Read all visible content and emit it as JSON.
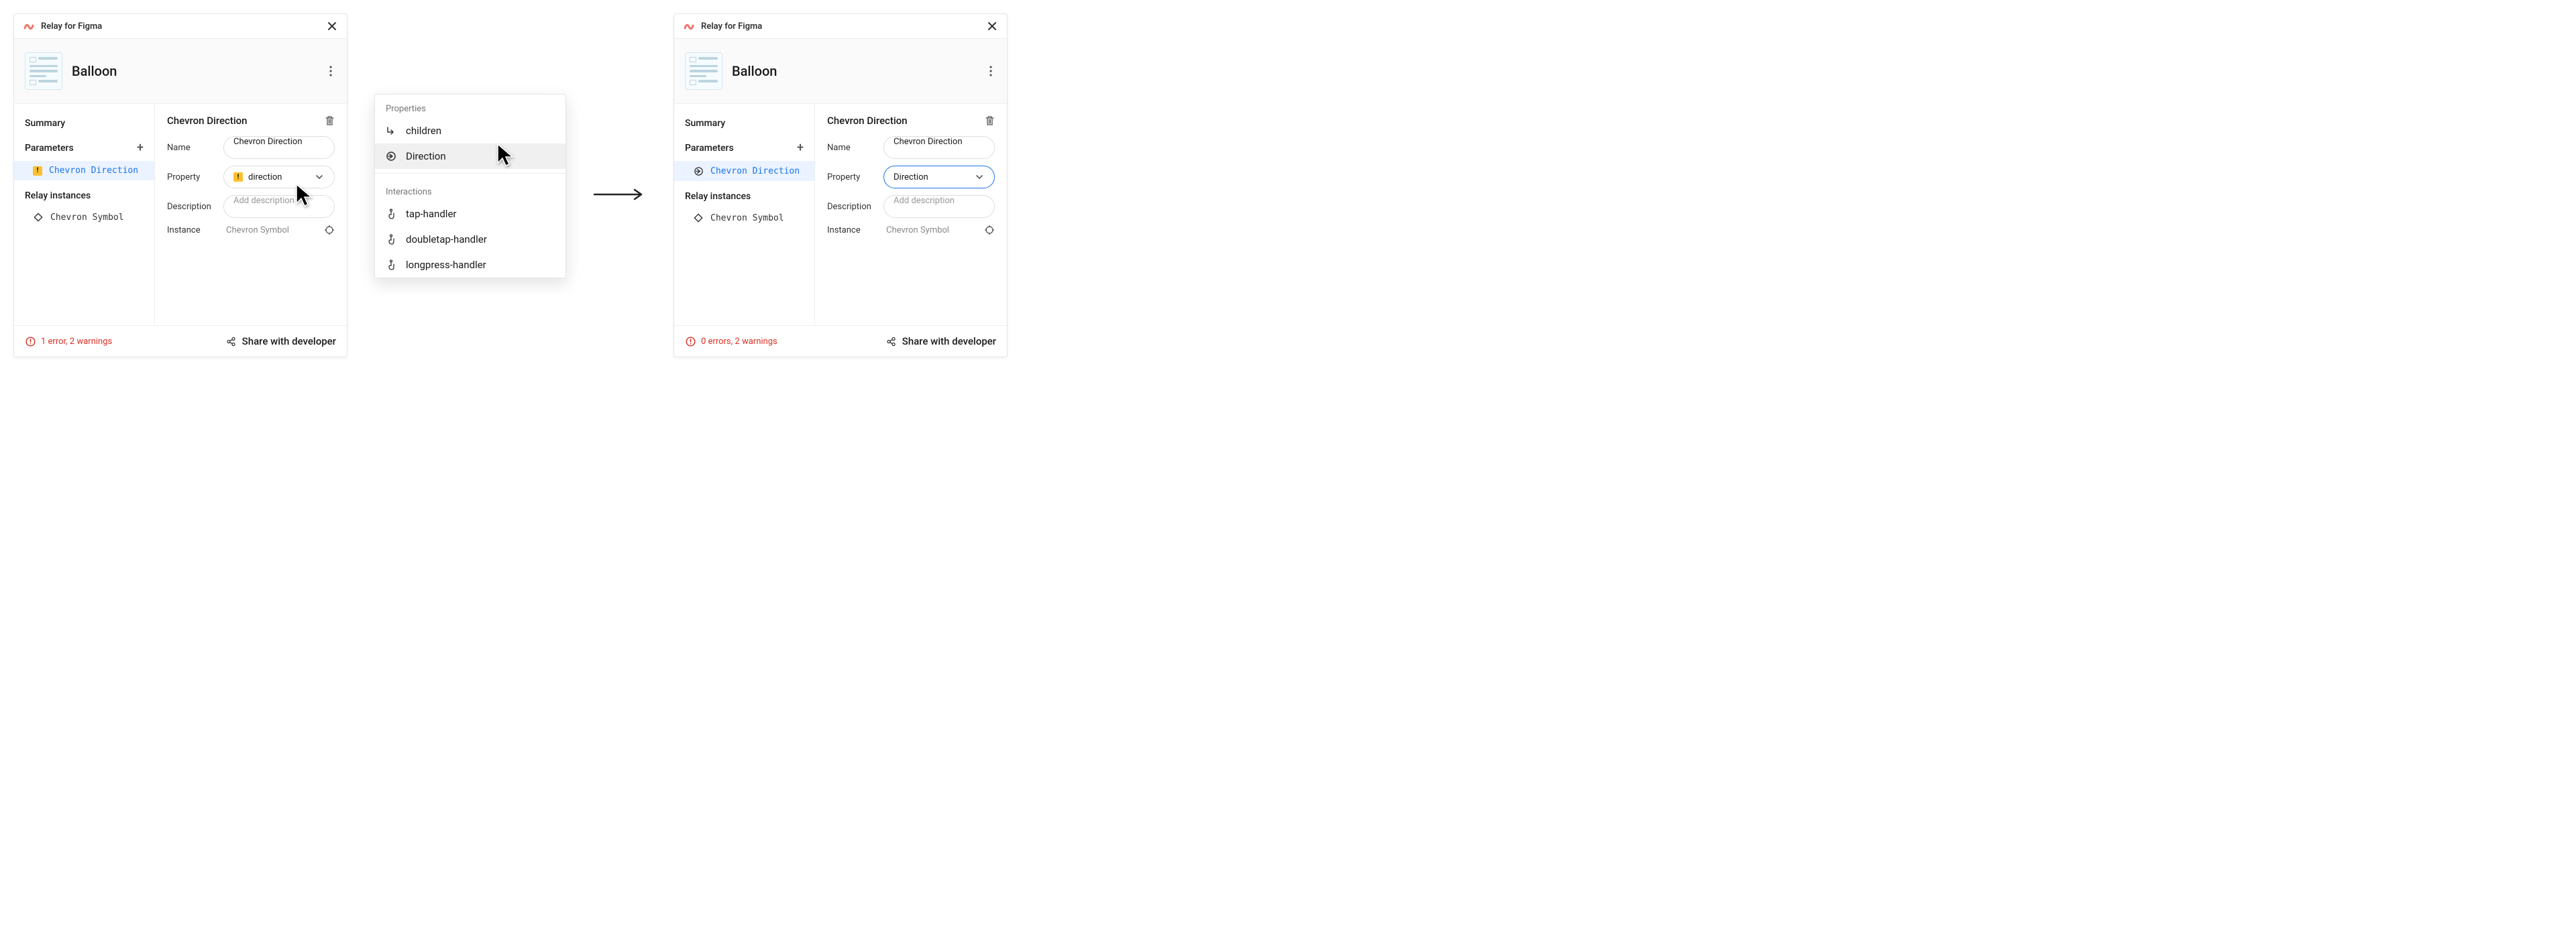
{
  "app": {
    "title": "Relay for Figma"
  },
  "component": {
    "name": "Balloon"
  },
  "sidebar": {
    "summary_label": "Summary",
    "parameters_label": "Parameters",
    "relay_instances_label": "Relay instances",
    "param_items": [
      "Chevron Direction"
    ],
    "instance_items": [
      "Chevron Symbol"
    ]
  },
  "content": {
    "title": "Chevron Direction",
    "labels": {
      "name": "Name",
      "property": "Property",
      "description": "Description",
      "instance": "Instance"
    },
    "name_value": "Chevron Direction",
    "description_placeholder": "Add description",
    "instance_value": "Chevron Symbol"
  },
  "left": {
    "property_value": "direction",
    "status": "1 error, 2 warnings"
  },
  "right": {
    "property_value": "Direction",
    "status": "0 errors, 2 warnings"
  },
  "footer": {
    "share_label": "Share with developer"
  },
  "popup": {
    "properties_label": "Properties",
    "interactions_label": "Interactions",
    "properties": [
      {
        "icon": "children",
        "label": "children"
      },
      {
        "icon": "direction",
        "label": "Direction"
      }
    ],
    "interactions": [
      {
        "icon": "tap",
        "label": "tap-handler"
      },
      {
        "icon": "tap",
        "label": "doubletap-handler"
      },
      {
        "icon": "tap",
        "label": "longpress-handler"
      }
    ]
  }
}
